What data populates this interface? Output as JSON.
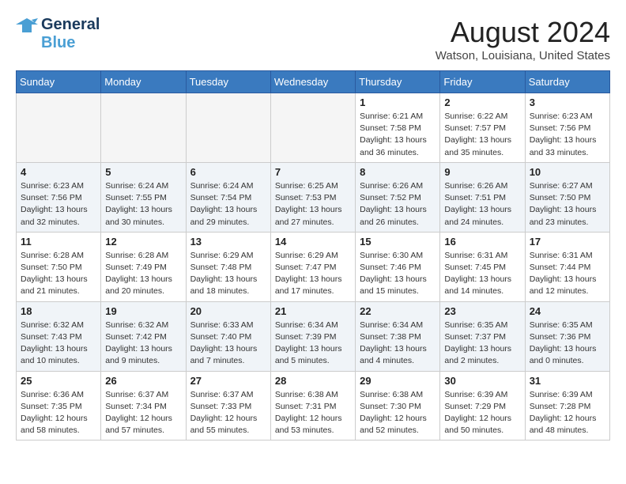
{
  "logo": {
    "line1": "General",
    "line2": "Blue"
  },
  "title": "August 2024",
  "location": "Watson, Louisiana, United States",
  "days_of_week": [
    "Sunday",
    "Monday",
    "Tuesday",
    "Wednesday",
    "Thursday",
    "Friday",
    "Saturday"
  ],
  "weeks": [
    [
      {
        "day": "",
        "empty": true
      },
      {
        "day": "",
        "empty": true
      },
      {
        "day": "",
        "empty": true
      },
      {
        "day": "",
        "empty": true
      },
      {
        "day": "1",
        "sunrise": "6:21 AM",
        "sunset": "7:58 PM",
        "daylight": "13 hours and 36 minutes."
      },
      {
        "day": "2",
        "sunrise": "6:22 AM",
        "sunset": "7:57 PM",
        "daylight": "13 hours and 35 minutes."
      },
      {
        "day": "3",
        "sunrise": "6:23 AM",
        "sunset": "7:56 PM",
        "daylight": "13 hours and 33 minutes."
      }
    ],
    [
      {
        "day": "4",
        "sunrise": "6:23 AM",
        "sunset": "7:56 PM",
        "daylight": "13 hours and 32 minutes."
      },
      {
        "day": "5",
        "sunrise": "6:24 AM",
        "sunset": "7:55 PM",
        "daylight": "13 hours and 30 minutes."
      },
      {
        "day": "6",
        "sunrise": "6:24 AM",
        "sunset": "7:54 PM",
        "daylight": "13 hours and 29 minutes."
      },
      {
        "day": "7",
        "sunrise": "6:25 AM",
        "sunset": "7:53 PM",
        "daylight": "13 hours and 27 minutes."
      },
      {
        "day": "8",
        "sunrise": "6:26 AM",
        "sunset": "7:52 PM",
        "daylight": "13 hours and 26 minutes."
      },
      {
        "day": "9",
        "sunrise": "6:26 AM",
        "sunset": "7:51 PM",
        "daylight": "13 hours and 24 minutes."
      },
      {
        "day": "10",
        "sunrise": "6:27 AM",
        "sunset": "7:50 PM",
        "daylight": "13 hours and 23 minutes."
      }
    ],
    [
      {
        "day": "11",
        "sunrise": "6:28 AM",
        "sunset": "7:50 PM",
        "daylight": "13 hours and 21 minutes."
      },
      {
        "day": "12",
        "sunrise": "6:28 AM",
        "sunset": "7:49 PM",
        "daylight": "13 hours and 20 minutes."
      },
      {
        "day": "13",
        "sunrise": "6:29 AM",
        "sunset": "7:48 PM",
        "daylight": "13 hours and 18 minutes."
      },
      {
        "day": "14",
        "sunrise": "6:29 AM",
        "sunset": "7:47 PM",
        "daylight": "13 hours and 17 minutes."
      },
      {
        "day": "15",
        "sunrise": "6:30 AM",
        "sunset": "7:46 PM",
        "daylight": "13 hours and 15 minutes."
      },
      {
        "day": "16",
        "sunrise": "6:31 AM",
        "sunset": "7:45 PM",
        "daylight": "13 hours and 14 minutes."
      },
      {
        "day": "17",
        "sunrise": "6:31 AM",
        "sunset": "7:44 PM",
        "daylight": "13 hours and 12 minutes."
      }
    ],
    [
      {
        "day": "18",
        "sunrise": "6:32 AM",
        "sunset": "7:43 PM",
        "daylight": "13 hours and 10 minutes."
      },
      {
        "day": "19",
        "sunrise": "6:32 AM",
        "sunset": "7:42 PM",
        "daylight": "13 hours and 9 minutes."
      },
      {
        "day": "20",
        "sunrise": "6:33 AM",
        "sunset": "7:40 PM",
        "daylight": "13 hours and 7 minutes."
      },
      {
        "day": "21",
        "sunrise": "6:34 AM",
        "sunset": "7:39 PM",
        "daylight": "13 hours and 5 minutes."
      },
      {
        "day": "22",
        "sunrise": "6:34 AM",
        "sunset": "7:38 PM",
        "daylight": "13 hours and 4 minutes."
      },
      {
        "day": "23",
        "sunrise": "6:35 AM",
        "sunset": "7:37 PM",
        "daylight": "13 hours and 2 minutes."
      },
      {
        "day": "24",
        "sunrise": "6:35 AM",
        "sunset": "7:36 PM",
        "daylight": "13 hours and 0 minutes."
      }
    ],
    [
      {
        "day": "25",
        "sunrise": "6:36 AM",
        "sunset": "7:35 PM",
        "daylight": "12 hours and 58 minutes."
      },
      {
        "day": "26",
        "sunrise": "6:37 AM",
        "sunset": "7:34 PM",
        "daylight": "12 hours and 57 minutes."
      },
      {
        "day": "27",
        "sunrise": "6:37 AM",
        "sunset": "7:33 PM",
        "daylight": "12 hours and 55 minutes."
      },
      {
        "day": "28",
        "sunrise": "6:38 AM",
        "sunset": "7:31 PM",
        "daylight": "12 hours and 53 minutes."
      },
      {
        "day": "29",
        "sunrise": "6:38 AM",
        "sunset": "7:30 PM",
        "daylight": "12 hours and 52 minutes."
      },
      {
        "day": "30",
        "sunrise": "6:39 AM",
        "sunset": "7:29 PM",
        "daylight": "12 hours and 50 minutes."
      },
      {
        "day": "31",
        "sunrise": "6:39 AM",
        "sunset": "7:28 PM",
        "daylight": "12 hours and 48 minutes."
      }
    ]
  ]
}
